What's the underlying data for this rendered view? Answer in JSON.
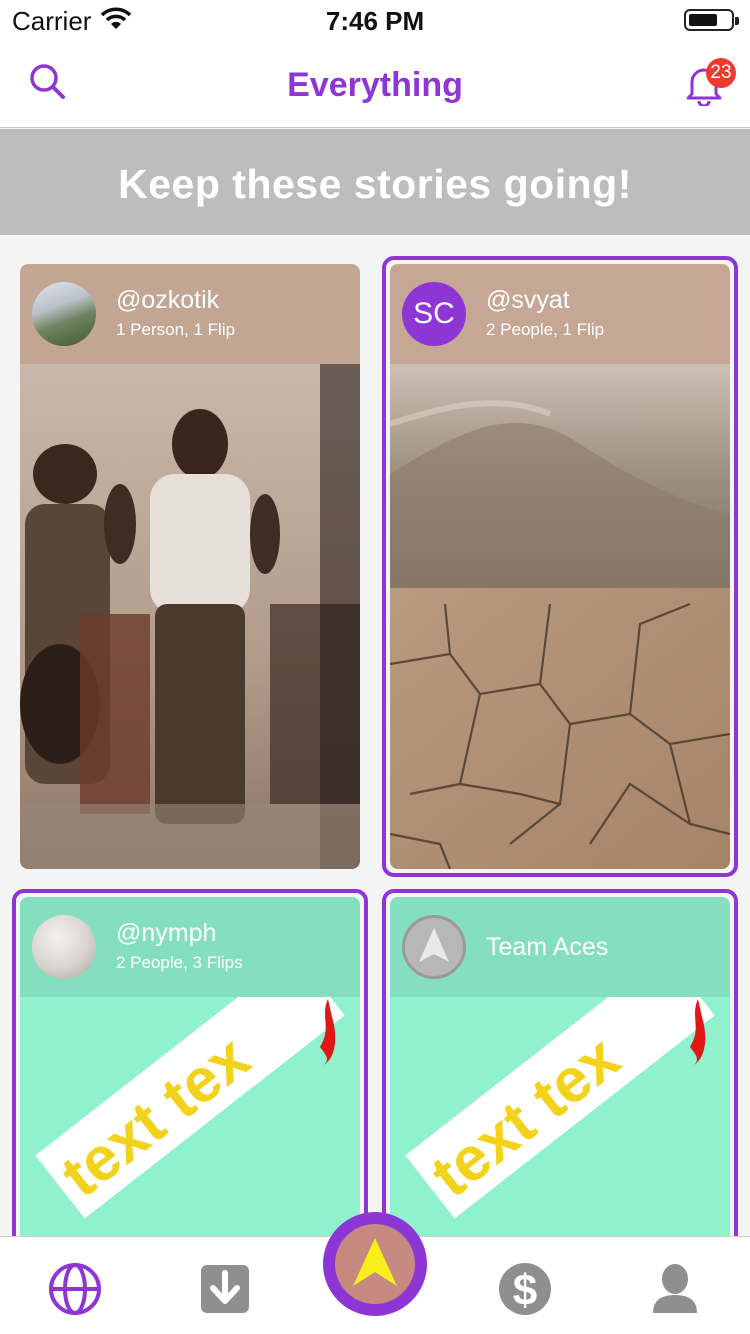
{
  "status_bar": {
    "carrier": "Carrier",
    "time": "7:46 PM"
  },
  "nav": {
    "title": "Everything",
    "notification_count": "23"
  },
  "banner": {
    "text": "Keep these stories going!"
  },
  "cards": [
    {
      "handle": "@ozkotik",
      "meta": "1 Person, 1 Flip"
    },
    {
      "handle": "@svyat",
      "meta": "2 People, 1 Flip",
      "avatar_initials": "SC"
    },
    {
      "handle": "@nymph",
      "meta": "2 People, 3 Flips",
      "sticker_text": "text tex"
    },
    {
      "handle": "Team Aces",
      "meta": "",
      "sticker_text": "text tex"
    }
  ],
  "tabs": [
    "globe-icon",
    "download-icon",
    "create-arrow-icon",
    "dollar-icon",
    "profile-icon"
  ],
  "colors": {
    "accent": "#8e35d6",
    "badge": "#ef3a2e",
    "banner": "#bdbdbd",
    "mint": "#90f1cf"
  }
}
